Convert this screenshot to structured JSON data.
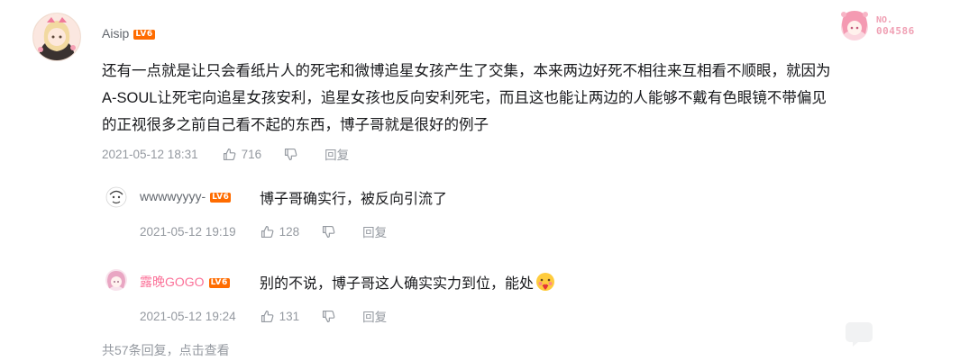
{
  "main_comment": {
    "username": "Aisip",
    "level": "LV6",
    "text_lines": [
      "还有一点就是让只会看纸片人的死宅和微博追星女孩产生了交集，本来两边好死不相往来互相看不顺眼，就因为",
      "A-SOUL让死宅向追星女孩安利，追星女孩也反向安利死宅，而且这也能让两边的人能够不戴有色眼镜不带偏见",
      "的正视很多之前自己看不起的东西，博子哥就是很好的例子"
    ],
    "time": "2021-05-12 18:31",
    "likes": "716",
    "reply_label": "回复",
    "badge": {
      "prefix": "NO.",
      "number": "004586"
    }
  },
  "replies": [
    {
      "username": "wwwwyyyy-",
      "level": "LV6",
      "text": "博子哥确实行，被反向引流了",
      "time": "2021-05-12 19:19",
      "likes": "128",
      "reply_label": "回复"
    },
    {
      "username": "露晚GOGO",
      "level": "LV6",
      "text": "别的不说，博子哥这人确实实力到位，能处",
      "time": "2021-05-12 19:24",
      "likes": "131",
      "reply_label": "回复"
    }
  ],
  "more_replies": "共57条回复，点击查看",
  "colors": {
    "level_badge": "#ff6c00",
    "vip_name": "#fb7299",
    "meta_text": "#9499a0"
  }
}
